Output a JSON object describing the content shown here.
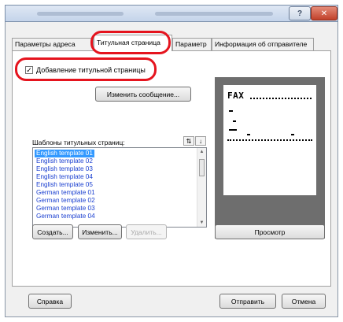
{
  "tabs": [
    {
      "label": "Параметры адреса"
    },
    {
      "label": "Титульная страница"
    },
    {
      "label": "Параметр"
    },
    {
      "label": "Информация об отправителе"
    }
  ],
  "cover": {
    "add_cover_label": "Добавление титульной страницы",
    "add_cover_checked": true,
    "edit_message_button": "Изменить сообщение...",
    "templates_label": "Шаблоны титульных страниц:",
    "templates": [
      "English template 01",
      "English template 02",
      "English template 03",
      "English template 04",
      "English template 05",
      "German template 01",
      "German template 02",
      "German template 03",
      "German template 04"
    ],
    "selected_index": 0,
    "create_button": "Создать...",
    "change_button": "Изменить...",
    "delete_button": "Удалить...",
    "preview_button": "Просмотр",
    "preview_title": "FAX"
  },
  "footer": {
    "help_button": "Справка",
    "send_button": "Отправить",
    "cancel_button": "Отмена"
  },
  "titlebar": {
    "help_glyph": "?",
    "close_glyph": "✕"
  },
  "icons": {
    "sort_asc": "⇅",
    "sort_desc": "↓",
    "scroll_up": "▲",
    "scroll_down": "▼",
    "check": "✓"
  },
  "colors": {
    "highlight": "#e5141e",
    "selection": "#3399ff",
    "link_text": "#1a3fd0"
  }
}
